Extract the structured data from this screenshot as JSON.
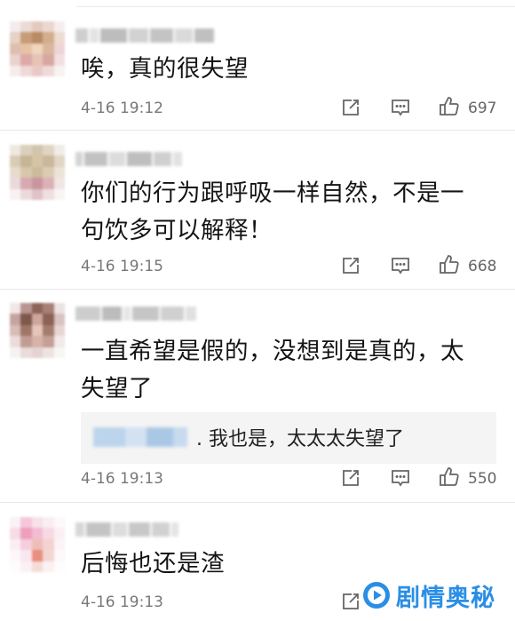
{
  "comments": [
    {
      "text_lines": [
        "唉，真的很失望"
      ],
      "time": "4-16 19:12",
      "likes": "697"
    },
    {
      "text_lines": [
        "你们的行为跟呼吸一样自然，不是一",
        "句饮多可以解释！"
      ],
      "time": "4-16 19:15",
      "likes": "668"
    },
    {
      "text_lines": [
        "一直希望是假的，没想到是真的，太",
        "失望了"
      ],
      "time": "4-16 19:13",
      "likes": "550",
      "reply": {
        "text": ". 我也是，太太太失望了"
      }
    },
    {
      "text_lines": [
        "后悔也还是渣"
      ],
      "time": "4-16 19:13",
      "likes": ""
    }
  ],
  "icons": {
    "share": "share-icon",
    "comment": "comment-icon",
    "like": "thumbs-up-icon"
  },
  "watermark": {
    "text": "剧情奥秘",
    "logo": "play-icon",
    "color": "#2a8ee6"
  },
  "colors": {
    "text": "#141414",
    "meta": "#777777",
    "reply_bg": "#f4f4f4"
  }
}
